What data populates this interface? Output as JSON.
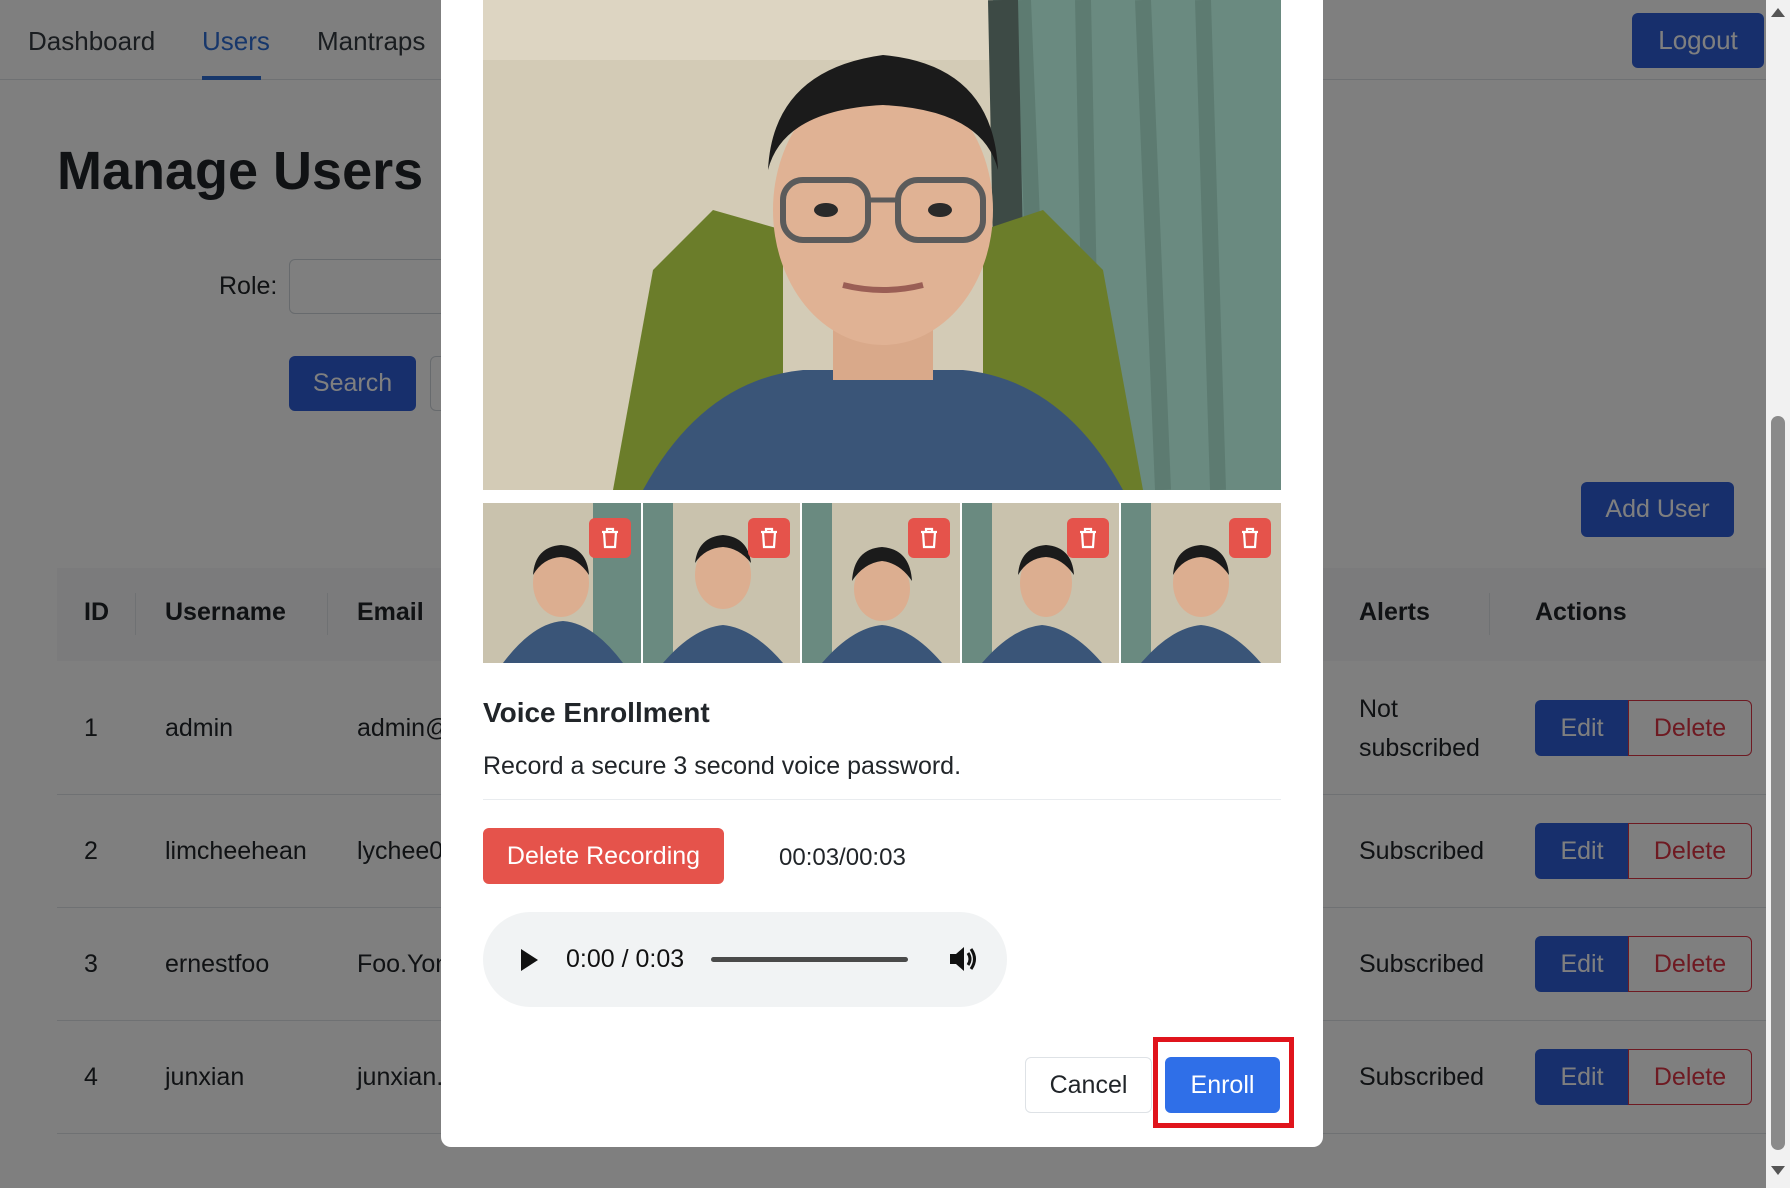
{
  "nav": {
    "items": [
      {
        "label": "Dashboard"
      },
      {
        "label": "Users"
      },
      {
        "label": "Mantraps"
      }
    ],
    "active": "Users",
    "logout_label": "Logout"
  },
  "page": {
    "title": "Manage Users",
    "role_label": "Role:",
    "search_label": "Search",
    "add_user_label": "Add User"
  },
  "table": {
    "headers": {
      "id": "ID",
      "username": "Username",
      "email": "Email",
      "alerts": "Alerts",
      "actions": "Actions"
    },
    "rows": [
      {
        "id": "1",
        "username": "admin",
        "email": "admin@",
        "alerts_line1": "Not",
        "alerts_line2": "subscribed"
      },
      {
        "id": "2",
        "username": "limcheehean",
        "email": "lychee0",
        "alerts": "Subscribed"
      },
      {
        "id": "3",
        "username": "ernestfoo",
        "email": "Foo.Yon",
        "alerts": "Subscribed"
      },
      {
        "id": "4",
        "username": "junxian",
        "email": "junxian.",
        "alerts": "Subscribed"
      }
    ],
    "edit_label": "Edit",
    "delete_label": "Delete"
  },
  "modal": {
    "thumbnail_count": 5,
    "voice_title": "Voice Enrollment",
    "voice_description": "Record a secure 3 second voice password.",
    "delete_recording_label": "Delete Recording",
    "timer": "00:03/00:03",
    "audio": {
      "current": "0:00 / 0:03",
      "progress_fraction": 0
    },
    "cancel_label": "Cancel",
    "enroll_label": "Enroll"
  },
  "colors": {
    "primary": "#2f5fd9",
    "enroll": "#2f6fe8",
    "danger": "#e5534b",
    "highlight": "#e0141c",
    "active_nav": "#2f6fd6"
  },
  "icons": {
    "thumbnail_delete": "trash-icon",
    "audio_play": "play-icon",
    "audio_volume": "volume-icon"
  }
}
